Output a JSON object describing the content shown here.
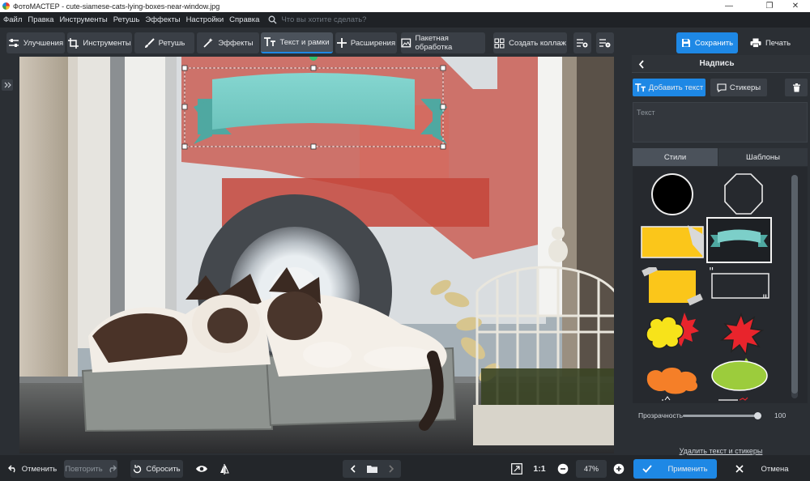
{
  "window": {
    "title": "ФотоМАСТЕР - cute-siamese-cats-lying-boxes-near-window.jpg"
  },
  "menu": {
    "items": [
      "Файл",
      "Правка",
      "Инструменты",
      "Ретушь",
      "Эффекты",
      "Настройки",
      "Справка"
    ],
    "search_placeholder": "Что вы хотите сделать?"
  },
  "toolbar": {
    "tabs": [
      {
        "label": "Улучшения",
        "icon": "sliders-icon"
      },
      {
        "label": "Инструменты",
        "icon": "crop-icon"
      },
      {
        "label": "Ретушь",
        "icon": "brush-icon"
      },
      {
        "label": "Эффекты",
        "icon": "magic-wand-icon"
      },
      {
        "label": "Текст и рамки",
        "icon": "text-icon",
        "active": true
      },
      {
        "label": "Расширения",
        "icon": "plus-icon"
      }
    ],
    "batch_label": "Пакетная обработка",
    "collage_label": "Создать коллаж",
    "save_label": "Сохранить",
    "print_label": "Печать"
  },
  "panel": {
    "title": "Надпись",
    "add_text_label": "Добавить текст",
    "stickers_label": "Стикеры",
    "text_placeholder": "Текст",
    "tabs": {
      "styles": "Стили",
      "templates": "Шаблоны"
    },
    "opacity_label": "Прозрачность",
    "opacity_value": "100",
    "opacity_fraction": 1.0,
    "delete_link": "Удалить текст и стикеры",
    "apply_label": "Применить",
    "cancel_label": "Отмена"
  },
  "bottom": {
    "undo_label": "Отменить",
    "redo_label": "Повторить",
    "reset_label": "Сбросить",
    "ratio_label": "1:1",
    "zoom_value": "47%"
  },
  "colors": {
    "accent": "#1e88e5",
    "ribbon": "#7ccfc9",
    "ribbon_dark": "#4fa8a1",
    "sticker_yellow": "#fbc61a",
    "burst_red": "#e8242c",
    "cloud_orange": "#f57f28",
    "cloud_green": "#9ccc3c"
  }
}
